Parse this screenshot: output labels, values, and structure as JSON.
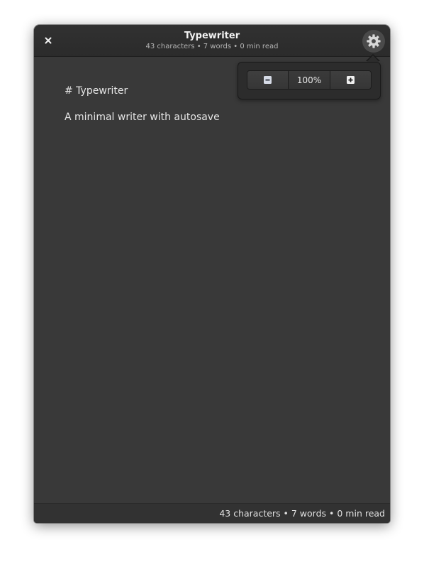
{
  "window": {
    "title": "Typewriter",
    "subtitle": "43 characters • 7 words • 0 min read",
    "close_icon": "close-icon",
    "settings_icon": "gear-icon"
  },
  "editor": {
    "lines": [
      "# Typewriter",
      "A minimal writer with autosave"
    ]
  },
  "statusbar": {
    "text": "43 characters • 7 words • 0 min read"
  },
  "zoom_popover": {
    "decrease_icon": "minus-icon",
    "level": "100%",
    "increase_icon": "plus-icon"
  },
  "colors": {
    "window_bg": "#393939",
    "headerbar_bg": "#2e2e2e",
    "text": "#e6e6e6"
  }
}
